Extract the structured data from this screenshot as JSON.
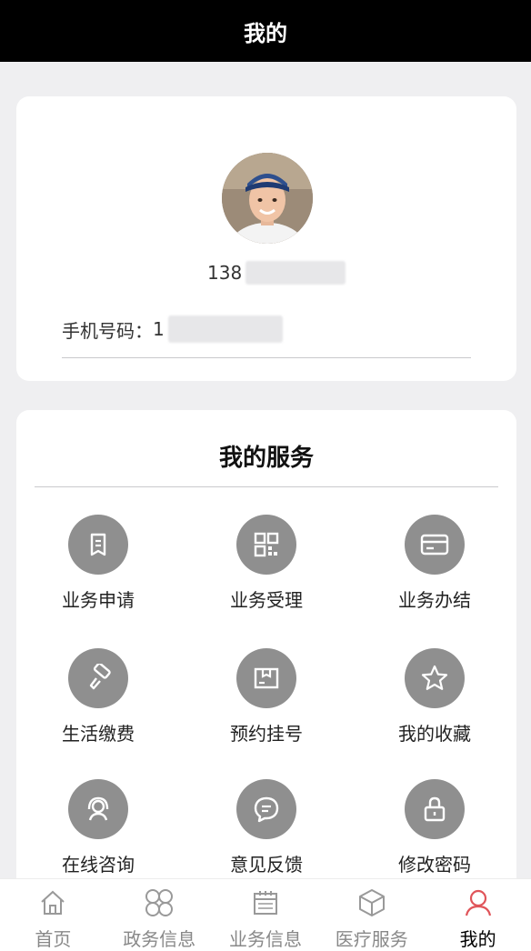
{
  "header": {
    "title": "我的"
  },
  "profile": {
    "username_prefix": "138",
    "phone_label": "手机号码：",
    "phone_prefix": "1"
  },
  "services": {
    "title": "我的服务",
    "items": [
      {
        "label": "业务申请",
        "icon": "document-icon"
      },
      {
        "label": "业务受理",
        "icon": "grid-icon"
      },
      {
        "label": "业务办结",
        "icon": "card-icon"
      },
      {
        "label": "生活缴费",
        "icon": "paint-roller-icon"
      },
      {
        "label": "预约挂号",
        "icon": "box-icon"
      },
      {
        "label": "我的收藏",
        "icon": "star-icon"
      },
      {
        "label": "在线咨询",
        "icon": "headset-icon"
      },
      {
        "label": "意见反馈",
        "icon": "chat-bubble-icon"
      },
      {
        "label": "修改密码",
        "icon": "lock-icon"
      }
    ]
  },
  "tabbar": {
    "items": [
      {
        "label": "首页",
        "icon": "home-icon"
      },
      {
        "label": "政务信息",
        "icon": "four-circles-icon"
      },
      {
        "label": "业务信息",
        "icon": "calendar-icon"
      },
      {
        "label": "医疗服务",
        "icon": "cube-icon"
      },
      {
        "label": "我的",
        "icon": "user-icon"
      }
    ],
    "active_index": 4
  },
  "colors": {
    "header_bg": "#000000",
    "page_bg": "#efeff1",
    "icon_circle": "#8f8f8f",
    "active_tab_icon": "#e0555a"
  }
}
